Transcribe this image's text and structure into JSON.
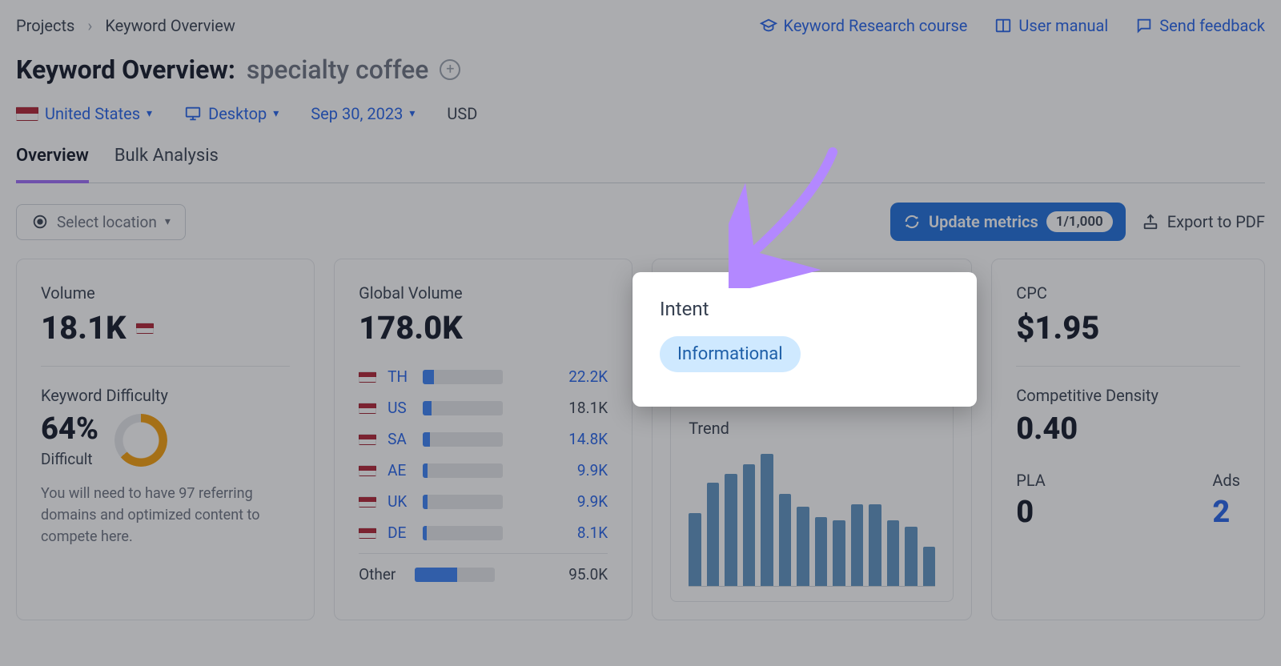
{
  "breadcrumb": {
    "root": "Projects",
    "current": "Keyword Overview"
  },
  "toplinks": {
    "course": "Keyword Research course",
    "manual": "User manual",
    "feedback": "Send feedback"
  },
  "title": {
    "label": "Keyword Overview:",
    "keyword": "specialty coffee"
  },
  "filters": {
    "country": "United States",
    "device": "Desktop",
    "date": "Sep 30, 2023",
    "currency": "USD"
  },
  "tabs": {
    "overview": "Overview",
    "bulk": "Bulk Analysis"
  },
  "actions": {
    "select_location": "Select location",
    "update_metrics": "Update metrics",
    "update_badge": "1/1,000",
    "export": "Export to PDF"
  },
  "volume": {
    "label": "Volume",
    "value": "18.1K",
    "kd_label": "Keyword Difficulty",
    "kd_value": "64%",
    "kd_tag": "Difficult",
    "kd_desc": "You will need to have 97 referring domains and optimized content to compete here."
  },
  "global": {
    "label": "Global Volume",
    "value": "178.0K",
    "rows": [
      {
        "cc": "TH",
        "val": "22.2K",
        "pct": 14
      },
      {
        "cc": "US",
        "val": "18.1K",
        "pct": 11
      },
      {
        "cc": "SA",
        "val": "14.8K",
        "pct": 9
      },
      {
        "cc": "AE",
        "val": "9.9K",
        "pct": 6
      },
      {
        "cc": "UK",
        "val": "9.9K",
        "pct": 6
      },
      {
        "cc": "DE",
        "val": "8.1K",
        "pct": 5
      }
    ],
    "other_label": "Other",
    "other_val": "95.0K",
    "other_pct": 53
  },
  "intent": {
    "label": "Intent",
    "value": "Informational"
  },
  "trend": {
    "label": "Trend"
  },
  "cpc": {
    "label": "CPC",
    "value": "$1.95",
    "cd_label": "Competitive Density",
    "cd_value": "0.40",
    "pla_label": "PLA",
    "pla_value": "0",
    "ads_label": "Ads",
    "ads_value": "2"
  },
  "chart_data": {
    "type": "bar",
    "title": "Trend",
    "categories": [
      "m1",
      "m2",
      "m3",
      "m4",
      "m5",
      "m6",
      "m7",
      "m8",
      "m9",
      "m10",
      "m11",
      "m12",
      "m13",
      "m14"
    ],
    "values": [
      55,
      78,
      85,
      92,
      100,
      70,
      60,
      52,
      50,
      62,
      62,
      50,
      45,
      30
    ],
    "ylim": [
      0,
      100
    ]
  }
}
